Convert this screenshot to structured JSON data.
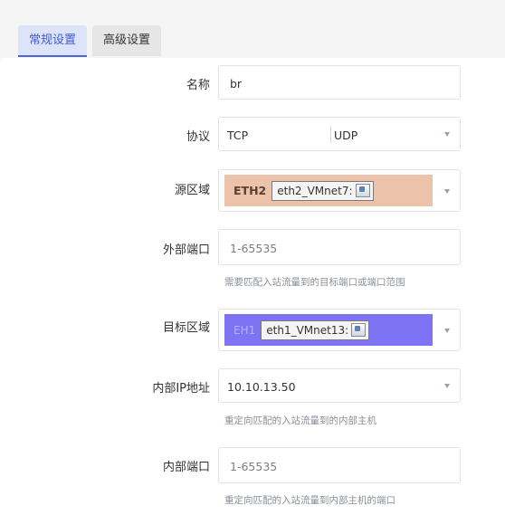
{
  "tabs": [
    {
      "label": "常规设置",
      "active": true
    },
    {
      "label": "高级设置",
      "active": false
    }
  ],
  "form": {
    "name": {
      "label": "名称",
      "value": "br"
    },
    "protocol": {
      "label": "协议",
      "options": [
        "TCP",
        "UDP"
      ]
    },
    "source_zone": {
      "label": "源区域",
      "zone_tag": "ETH2",
      "chip_text": "eth2_VMnet7:",
      "bg_color": "#ecc2ab"
    },
    "external_port": {
      "label": "外部端口",
      "placeholder": "1-65535",
      "help": "需要匹配入站流量到的目标端口或端口范围"
    },
    "dest_zone": {
      "label": "目标区域",
      "zone_tag": "EH1",
      "chip_text": "eth1_VMnet13:",
      "bg_color": "#7d73f3"
    },
    "internal_ip": {
      "label": "内部IP地址",
      "value": "10.10.13.50",
      "help": "重定向匹配的入站流量到的内部主机"
    },
    "internal_port": {
      "label": "内部端口",
      "placeholder": "1-65535",
      "help": "重定向匹配的入站流量到内部主机的端口"
    }
  }
}
